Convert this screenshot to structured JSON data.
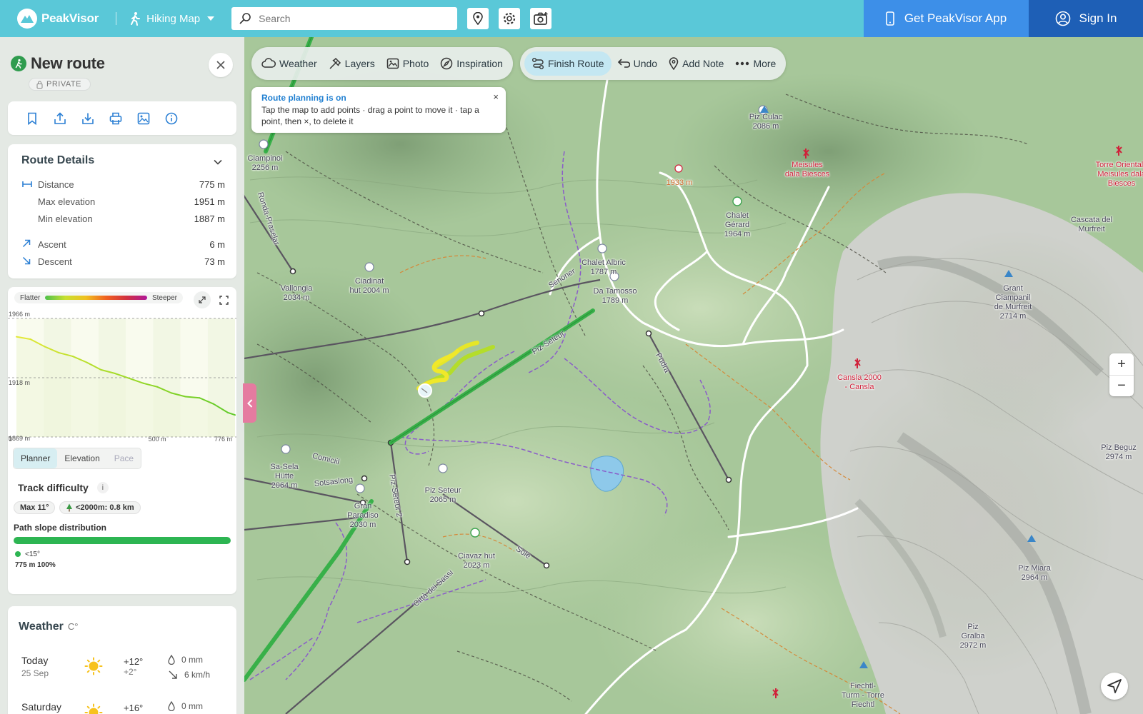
{
  "topbar": {
    "brand": "PeakVisor",
    "mode": "Hiking Map",
    "search_placeholder": "Search",
    "get_app": "Get PeakVisor App",
    "sign_in": "Sign In",
    "icons": [
      "location-pin-icon",
      "gear-icon",
      "camera-icon"
    ]
  },
  "map": {
    "toolbar": [
      "Weather",
      "Layers",
      "Photo",
      "Inspiration"
    ],
    "route_toolbar": [
      "Finish Route",
      "Undo",
      "Add Note",
      "More"
    ],
    "note": {
      "title": "Route planning is on",
      "text": "Tap the map to add points · drag a point to move it · tap a point, then ×, to delete it",
      "close": "×"
    },
    "zoom_in": "+",
    "zoom_out": "−",
    "labels": [
      {
        "text": "Piz Culac\n2086 m",
        "style": "normal"
      },
      {
        "text": "Meisules\ndala Biesces",
        "style": "red"
      },
      {
        "text": "Torre Orientale\nMeisules dala\nBiesces",
        "style": "red"
      },
      {
        "text": "1933 m",
        "style": "orange"
      },
      {
        "text": "Chalet\nGérard\n1964 m",
        "style": "normal"
      },
      {
        "text": "Cascata del\nMurfreit",
        "style": "normal"
      },
      {
        "text": "Ciampinoi\n2256 m",
        "style": "normal"
      },
      {
        "text": "Chalet Albric\n1787 m",
        "style": "normal"
      },
      {
        "text": "Da Tamosso\n1789 m",
        "style": "normal"
      },
      {
        "text": "Grant\nCiampanil\nde Murfreit\n2714 m",
        "style": "normal"
      },
      {
        "text": "Vallongia\n2034 m",
        "style": "normal"
      },
      {
        "text": "Ciadinat\nhut 2004 m",
        "style": "normal"
      },
      {
        "text": "Cansla 2000\n- Cansla",
        "style": "red"
      },
      {
        "text": "Piz Beguz\n2974 m",
        "style": "normal"
      },
      {
        "text": "Sa-Sela\nHütte\n2064 m",
        "style": "normal"
      },
      {
        "text": "Piz Seteur\n2065 m",
        "style": "normal"
      },
      {
        "text": "Gran\nParadiso\n2030 m",
        "style": "normal"
      },
      {
        "text": "Ciavaz hut\n2023 m",
        "style": "normal"
      },
      {
        "text": "Piz Miara\n2964 m",
        "style": "normal"
      },
      {
        "text": "Piz\nGralba\n2972 m",
        "style": "normal"
      },
      {
        "text": "Fiechtl-\nTurm - Torre\nFiechtl",
        "style": "normal"
      },
      {
        "text": "Senoner",
        "style": "normal"
      },
      {
        "text": "Piz-Seteur",
        "style": "normal"
      },
      {
        "text": "Pudra",
        "style": "normal"
      },
      {
        "text": "Comiciil",
        "style": "normal"
      },
      {
        "text": "Sotsaslong",
        "style": "normal"
      },
      {
        "text": "Piz-Seteur 2",
        "style": "normal"
      },
      {
        "text": "Sole",
        "style": "normal"
      },
      {
        "text": "Città dei Sassi",
        "style": "normal"
      },
      {
        "text": "Ronda-Praselar",
        "style": "normal"
      }
    ]
  },
  "sidebar": {
    "title": "New route",
    "privacy": "PRIVATE",
    "actions": [
      "bookmark-icon",
      "share-icon",
      "download-icon",
      "print-icon",
      "image-icon",
      "info-icon"
    ],
    "details": {
      "title": "Route Details",
      "distance_label": "Distance",
      "distance": "775 m",
      "max_label": "Max elevation",
      "max": "1951 m",
      "min_label": "Min elevation",
      "min": "1887 m",
      "ascent_label": "Ascent",
      "ascent": "6 m",
      "descent_label": "Descent",
      "descent": "73 m"
    },
    "profile": {
      "flatter": "Flatter",
      "steeper": "Steeper",
      "y_top": "1966 m",
      "y_mid": "1918 m",
      "y_bottom": "1869 m",
      "x_start": "0",
      "x_mid": "500 m",
      "x_end": "776 m",
      "tabs": [
        "Planner",
        "Elevation",
        "Pace"
      ],
      "active_tab": "Planner"
    },
    "difficulty": {
      "title": "Track difficulty",
      "info": "i",
      "max_slope": "Max 11°",
      "below_2000": "<2000m: 0.8 km",
      "slope_title": "Path slope distribution",
      "bucket_label": "<15°",
      "bucket_value": "775 m 100%",
      "bucket_fraction": 1.0
    },
    "weather": {
      "title": "Weather",
      "unit": "C°",
      "days": [
        {
          "day": "Today",
          "date": "25 Sep",
          "hi": "+12°",
          "lo": "+2°",
          "rain": "0 mm",
          "wind": "6 km/h"
        },
        {
          "day": "Saturday",
          "date": "",
          "hi": "+16°",
          "lo": "",
          "rain": "0 mm",
          "wind": ""
        }
      ]
    }
  },
  "chart_data": {
    "type": "area",
    "title": "",
    "xlabel": "",
    "ylabel": "",
    "x_unit": "m",
    "y_unit": "m",
    "xlim": [
      0,
      776
    ],
    "ylim": [
      1869,
      1966
    ],
    "x": [
      0,
      50,
      100,
      150,
      200,
      250,
      300,
      350,
      400,
      450,
      500,
      550,
      600,
      650,
      700,
      750,
      776
    ],
    "series": [
      {
        "name": "",
        "values": [
          1951,
          1949,
          1943,
          1938,
          1935,
          1930,
          1924,
          1921,
          1917,
          1913,
          1910,
          1905,
          1902,
          1901,
          1896,
          1889,
          1887
        ]
      }
    ]
  },
  "colors": {
    "topbar": "#5ac8d8",
    "get_app": "#3d8fe8",
    "sign_in": "#1e5fb6",
    "route_green": "#2db552",
    "route_yellow": "#e8e822",
    "accent_blue": "#1f7fd1"
  }
}
